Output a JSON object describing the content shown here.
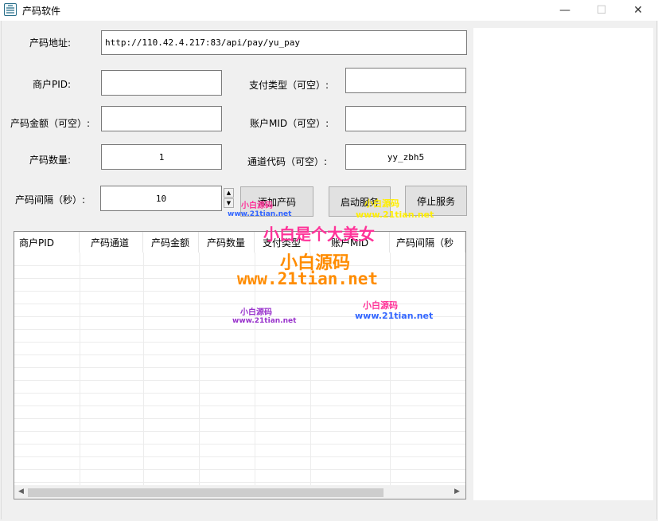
{
  "window": {
    "title": "产码软件",
    "min_glyph": "—",
    "max_glyph": "☐",
    "close_glyph": "✕"
  },
  "form": {
    "url_label": "产码地址:",
    "url_value": "http://110.42.4.217:83/api/pay/yu_pay",
    "pid_label": "商户PID:",
    "pid_value": "",
    "paytype_label": "支付类型（可空）:",
    "paytype_value": "",
    "amount_label": "产码金额（可空）:",
    "amount_value": "",
    "mid_label": "账户MID（可空）:",
    "mid_value": "",
    "count_label": "产码数量:",
    "count_value": "1",
    "channel_label": "通道代码（可空）:",
    "channel_value": "yy_zbh5",
    "interval_label": "产码间隔（秒）:",
    "interval_value": "10"
  },
  "buttons": {
    "add": "添加产码",
    "start": "启动服务",
    "stop": "停止服务"
  },
  "grid": {
    "columns": [
      "商户PID",
      "产码通道",
      "产码金额",
      "产码数量",
      "支付类型",
      "账户MID",
      "产码间隔（秒"
    ]
  },
  "watermarks": {
    "big_slogan": "小白是个大美女",
    "big_brand": "小白源码",
    "big_url": "www.21tian.net",
    "small_brand": "小白源码",
    "small_url": "www.21tian.net",
    "small_brand_spaced": "小白源码",
    "small_url_2": "www.21tian.net"
  },
  "colors": {
    "pink": "#ff3399",
    "orange": "#ff8c00",
    "yellow": "#ffee00",
    "purple": "#9933cc",
    "blue_url": "#3366ff"
  }
}
